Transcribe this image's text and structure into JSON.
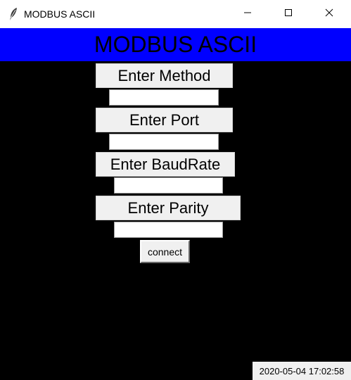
{
  "window": {
    "title": "MODBUS ASCII",
    "icon": "feather-icon",
    "controls": [
      "minimize-icon",
      "maximize-icon",
      "close-icon"
    ]
  },
  "banner": {
    "text": "MODBUS ASCII",
    "background": "#0000ff"
  },
  "form": {
    "method_label": "Enter Method",
    "method_value": "",
    "port_label": "Enter Port",
    "port_value": "",
    "baudrate_label": "Enter BaudRate",
    "baudrate_value": "",
    "parity_label": "Enter Parity",
    "parity_value": "",
    "connect_label": "connect"
  },
  "status": {
    "datetime": "2020-05-04 17:02:58"
  },
  "colors": {
    "background": "#000000",
    "banner": "#0000ff",
    "button_face": "#f0f0f0"
  }
}
